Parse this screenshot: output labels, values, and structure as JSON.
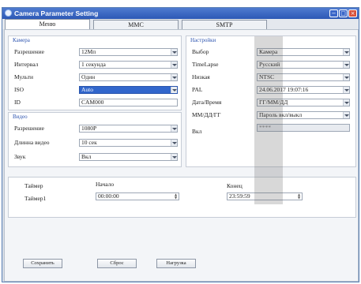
{
  "window": {
    "title": "Camera Parameter Setting",
    "minimize_glyph": "−",
    "maximize_glyph": "□",
    "close_glyph": "×"
  },
  "tabs": [
    {
      "label": "Меню",
      "active": true
    },
    {
      "label": "MMC"
    },
    {
      "label": "SMTP"
    }
  ],
  "camera": {
    "title": "Камера",
    "resolution": {
      "label": "Разрешение",
      "value": "12Mп"
    },
    "interval": {
      "label": "Интервал",
      "value": "1 секунда"
    },
    "multi": {
      "label": "Мульти",
      "value": "Один"
    },
    "iso": {
      "label": "ISO",
      "value": "Auto"
    },
    "id": {
      "label": "ID",
      "value": "CAM000"
    }
  },
  "video": {
    "title": "Видео",
    "resolution": {
      "label": "Разрешение",
      "value": "1080P"
    },
    "length": {
      "label": "Длинна видео",
      "value": "10 сек"
    },
    "sound": {
      "label": "Звук",
      "value": "Вкл"
    }
  },
  "settings": {
    "title": "Настройки",
    "mode": {
      "label": "Выбор",
      "value": "Камера"
    },
    "timelapse": {
      "label": "TimeLapse",
      "value": "Русский"
    },
    "lowlight": {
      "label": "Низкая",
      "value": "NTSC"
    },
    "pal": {
      "label": "PAL",
      "value": "24.06.2017 19:07:16"
    },
    "datetime": {
      "label": "Дата/Время",
      "value": "ГГ/ММ/ДД"
    },
    "dateformat": {
      "label": "ММ/ДД/ГГ",
      "value": "Пароль вкл/выкл"
    },
    "password": {
      "label": "Вкл",
      "value": "****"
    }
  },
  "timer": {
    "label": "Таймер",
    "row_label": "Таймер1",
    "start_label": "Начало",
    "end_label": "Конец",
    "start_value": "00:00:00",
    "end_value": "23:59:59"
  },
  "buttons": {
    "save": "Сохранить",
    "reset": "Сброс",
    "load": "Нагрузка"
  },
  "icons": {
    "dropdown": "chevron-down-icon",
    "spinner": "spinner-arrows-icon",
    "app": "camera-app-icon"
  },
  "colors": {
    "titlebar": "#2c58b5",
    "group_title": "#2e55b0",
    "selection": "#3166cc",
    "close": "#d9523b"
  }
}
